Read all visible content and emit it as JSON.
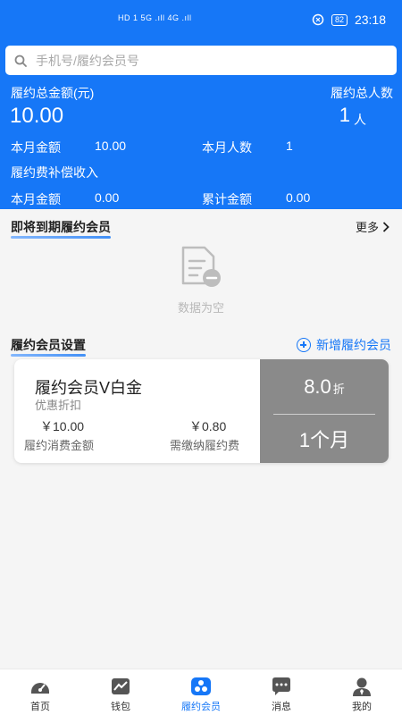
{
  "status_bar": {
    "network_left": "HD 1 5G .ıll 4G .ıll",
    "battery": "82",
    "time": "23:18"
  },
  "search": {
    "placeholder": "手机号/履约会员号"
  },
  "summary": {
    "total_label": "履约总金额(元)",
    "total_value": "10.00",
    "people_label": "履约总人数",
    "people_value": "1",
    "people_unit": "人",
    "month_amount_label": "本月金额",
    "month_amount_value": "10.00",
    "month_people_label": "本月人数",
    "month_people_value": "1",
    "compensation_title": "履约费补偿收入",
    "comp_month_label": "本月金额",
    "comp_month_value": "0.00",
    "comp_total_label": "累计金额",
    "comp_total_value": "0.00"
  },
  "expiring": {
    "title": "即将到期履约会员",
    "more": "更多",
    "empty_text": "数据为空"
  },
  "settings": {
    "title": "履约会员设置",
    "add_label": "新增履约会员",
    "card": {
      "name": "履约会员V白金",
      "subtitle": "优惠折扣",
      "consume_amount": "￥10.00",
      "consume_label": "履约消费金额",
      "fee_amount": "￥0.80",
      "fee_label": "需缴纳履约费",
      "discount": "8.0",
      "discount_unit": "折",
      "duration": "1个月"
    }
  },
  "tabbar": [
    {
      "label": "首页",
      "icon": "dashboard-icon"
    },
    {
      "label": "钱包",
      "icon": "wallet-chart-icon"
    },
    {
      "label": "履约会员",
      "icon": "members-icon",
      "active": true
    },
    {
      "label": "消息",
      "icon": "message-icon"
    },
    {
      "label": "我的",
      "icon": "user-icon"
    }
  ],
  "colors": {
    "primary": "#1677f7",
    "card_right": "#8a8a8a",
    "background": "#f5f5f5"
  }
}
